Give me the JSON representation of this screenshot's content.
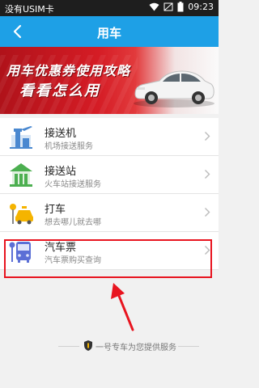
{
  "statusbar": {
    "carrier": "没有USIM卡",
    "time": "09:23"
  },
  "navbar": {
    "title": "用车",
    "back_icon": "chevron-left-icon"
  },
  "banner": {
    "line1": "用车优惠券使用攻略",
    "line2": "看看怎么用"
  },
  "items": [
    {
      "name": "接送机",
      "desc": "机场接送服务",
      "icon": "airport-icon",
      "color": "#4a88d0"
    },
    {
      "name": "接送站",
      "desc": "火车站接送服务",
      "icon": "train-station-icon",
      "color": "#4caf50"
    },
    {
      "name": "打车",
      "desc": "想去哪儿就去哪",
      "icon": "taxi-icon",
      "color": "#f5b400"
    },
    {
      "name": "汽车票",
      "desc": "汽车票购买查询",
      "icon": "bus-ticket-icon",
      "color": "#5b6fd6"
    }
  ],
  "footer": {
    "text": "一号专车为您提供服务"
  },
  "colors": {
    "accent": "#1ea0e6",
    "highlight": "#e8141f"
  }
}
